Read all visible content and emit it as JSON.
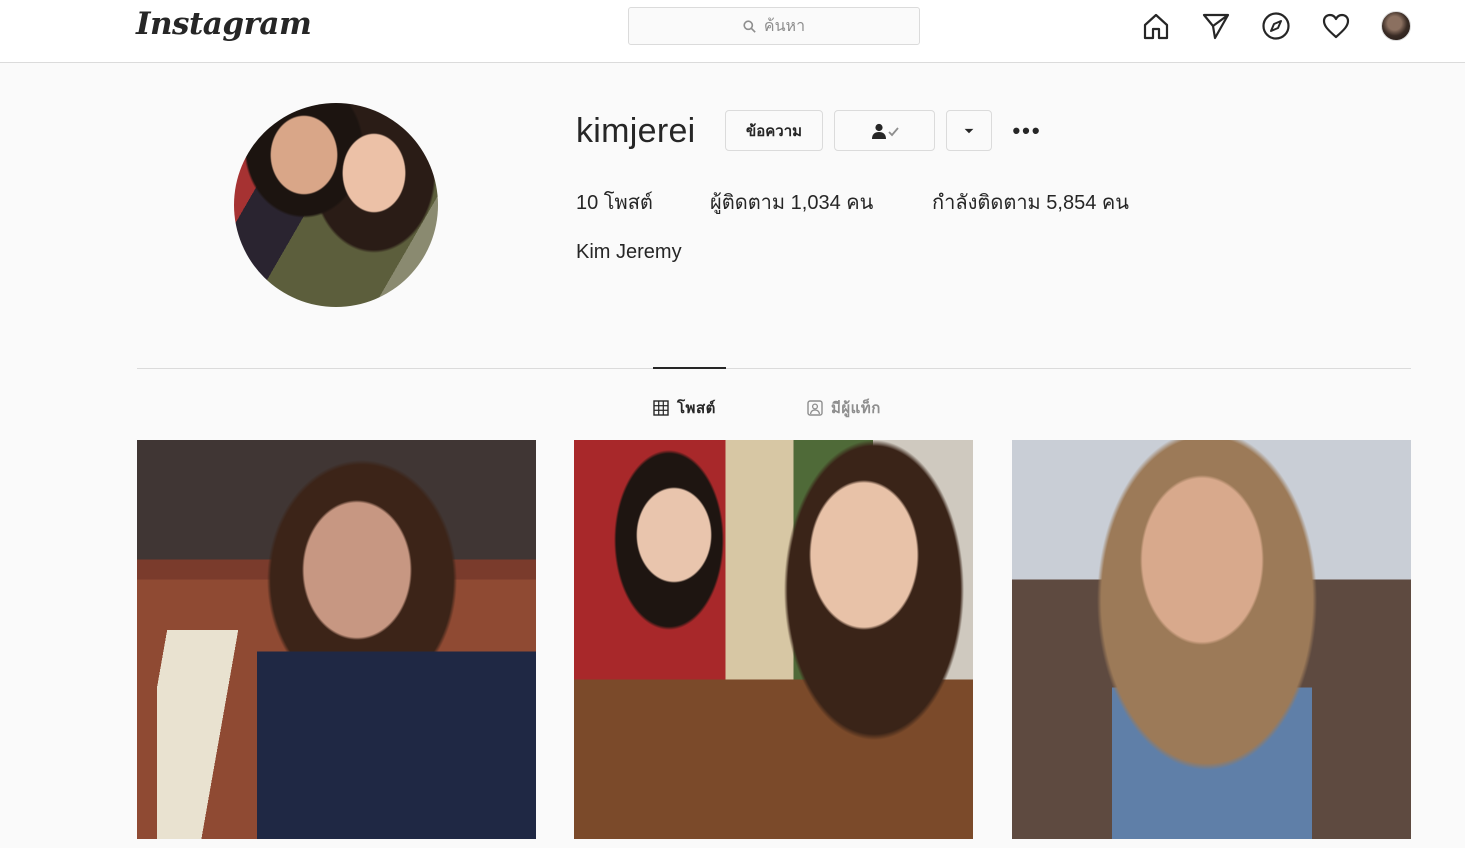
{
  "nav": {
    "logo": "Instagram",
    "search_placeholder": "ค้นหา",
    "icons": [
      "home-icon",
      "direct-icon",
      "explore-icon",
      "activity-icon",
      "profile-avatar"
    ]
  },
  "profile": {
    "username": "kimjerei",
    "message_button": "ข้อความ",
    "posts": "10 โพสต์",
    "followers": "ผู้ติดตาม 1,034 คน",
    "following": "กำลังติดตาม 5,854 คน",
    "full_name": "Kim Jeremy"
  },
  "tabs": [
    {
      "label": "โพสต์",
      "active": true
    },
    {
      "label": "มีผู้แท็ก",
      "active": false
    }
  ],
  "colors": {
    "text": "#262626",
    "muted": "#8e8e8e",
    "border": "#dbdbdb",
    "background": "#fafafa"
  }
}
